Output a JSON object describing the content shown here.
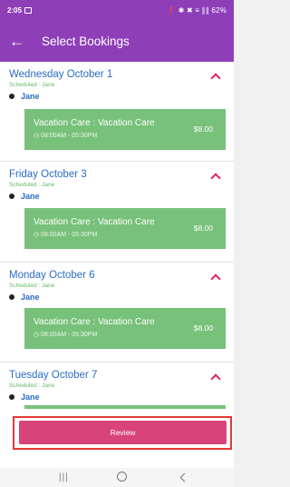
{
  "status_bar": {
    "time": "2:05",
    "indicators": "❗ ✱ ✖ ≡ ∥∥ 62%"
  },
  "header": {
    "title": "Select Bookings",
    "back_icon": "arrow-left-icon"
  },
  "bookings": [
    {
      "day": "Wednesday October 1",
      "scheduled": "Scheduled : Jane",
      "person": "Jane",
      "card": {
        "name": "Vacation Care : Vacation Care",
        "time": "◷ 08:00AM - 05:30PM",
        "price": "$8.00"
      }
    },
    {
      "day": "Friday October 3",
      "scheduled": "Scheduled : Jane",
      "person": "Jane",
      "card": {
        "name": "Vacation Care : Vacation Care",
        "time": "◷ 08:00AM - 05:30PM",
        "price": "$8.00"
      }
    },
    {
      "day": "Monday October 6",
      "scheduled": "Scheduled : Jane",
      "person": "Jane",
      "card": {
        "name": "Vacation Care : Vacation Care",
        "time": "◷ 08:00AM - 05:30PM",
        "price": "$8.00"
      }
    },
    {
      "day": "Tuesday October 7",
      "scheduled": "Scheduled : Jane",
      "person": "Jane",
      "card": {
        "name": "",
        "time": "",
        "price": ""
      }
    }
  ],
  "footer": {
    "review_label": "Review"
  },
  "nav": {
    "recent": "|||"
  },
  "colors": {
    "primary": "#8e3fb8",
    "accent": "#d84479",
    "card": "#78c17a",
    "link": "#2b6cc4",
    "chevron": "#e0245e"
  }
}
